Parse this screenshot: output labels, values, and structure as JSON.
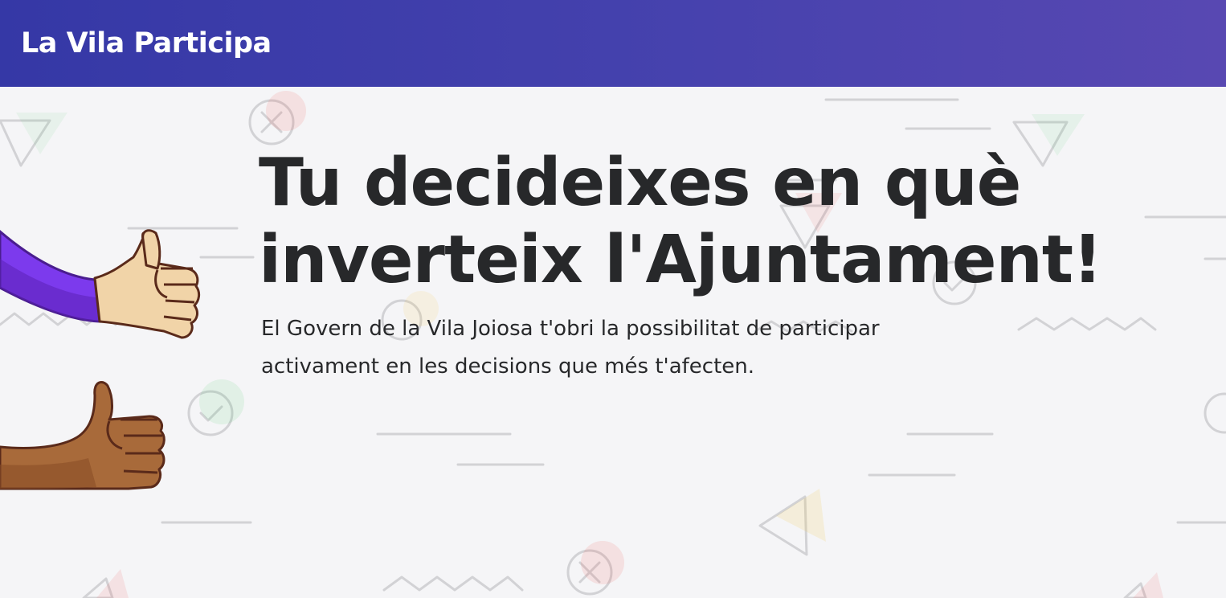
{
  "header": {
    "brand": "La Vila Participa"
  },
  "hero": {
    "headline_line1": "Tu decideixes en què",
    "headline_line2": "inverteix l'Ajuntament!",
    "lead_line1": "El Govern de la Vila Joiosa t'obri la possibilitat de participar",
    "lead_line2": "activament en les decisions que més t'afecten."
  },
  "colors": {
    "header_start": "#3538a6",
    "header_end": "#5848b2",
    "background": "#f5f5f7",
    "text": "#27282a",
    "sleeve": "#7c3aed"
  }
}
